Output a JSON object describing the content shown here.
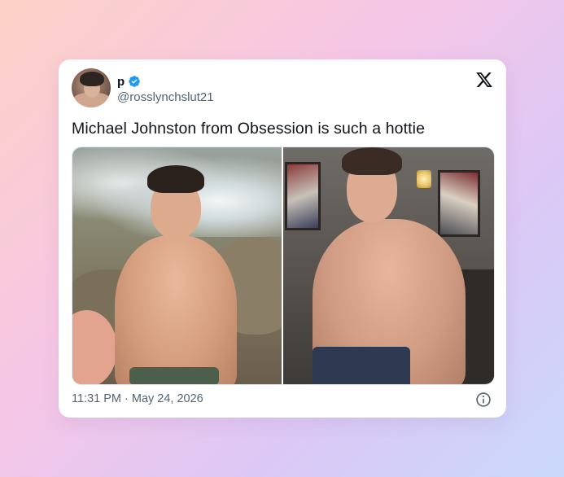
{
  "tweet": {
    "display_name": "p",
    "handle": "@rosslynchslut21",
    "verified": true,
    "text": "Michael Johnston from Obsession is such a hottie",
    "timestamp": "11:31 PM · May 24, 2026",
    "media_count": 2
  },
  "icons": {
    "logo": "x-logo-icon",
    "verified": "verified-badge-icon",
    "info": "info-icon"
  },
  "colors": {
    "verified_blue": "#1d9bf0",
    "text": "#0f1419",
    "secondary": "#536471"
  }
}
